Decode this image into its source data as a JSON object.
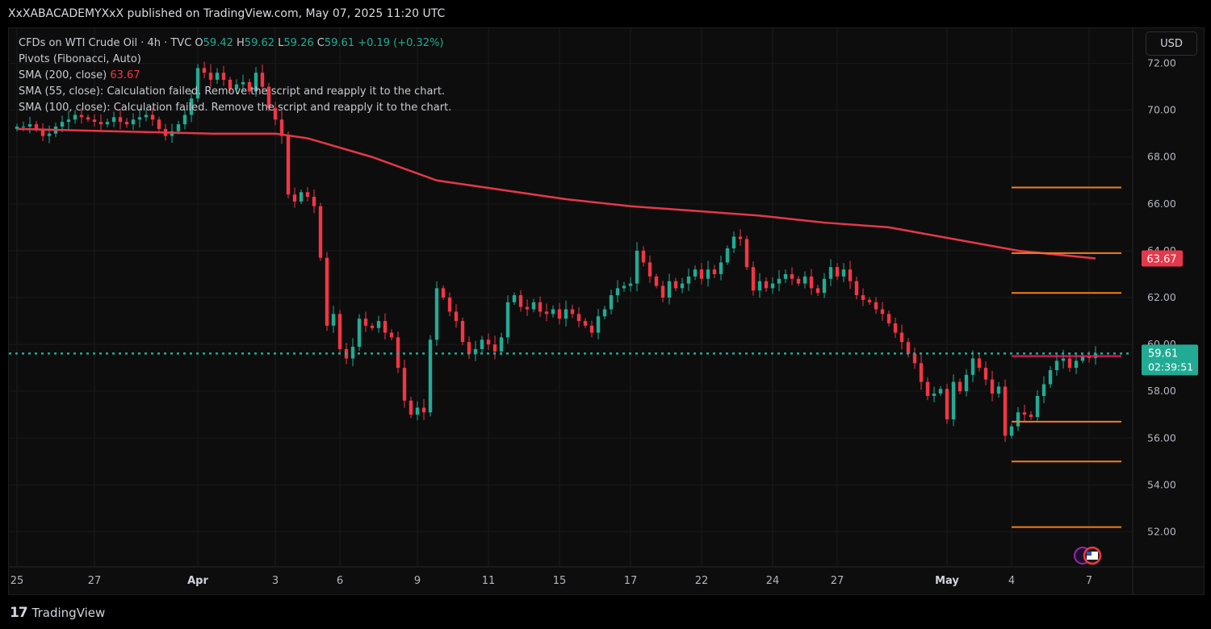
{
  "header": {
    "published": "XxXABACADEMYXxX published on TradingView.com, May 07, 2025 11:20 UTC"
  },
  "legend": {
    "symbol": "CFDs on WTI Crude Oil · 4h · TVC",
    "o_label": "O",
    "o_value": "59.42",
    "h_label": "H",
    "h_value": "59.62",
    "l_label": "L",
    "l_value": "59.26",
    "c_label": "C",
    "c_value": "59.61",
    "change": "+0.19 (+0.32%)",
    "pivots": "Pivots (Fibonacci, Auto)",
    "sma200_label": "SMA (200, close)",
    "sma200_value": "63.67",
    "sma55": "SMA (55, close): Calculation failed. Remove the script and reapply it to the chart.",
    "sma100": "SMA (100, close): Calculation failed. Remove the script and reapply it to the chart."
  },
  "currency_button": "USD",
  "price_tags": {
    "sma": "63.67",
    "last_price": "59.61",
    "countdown": "02:39:51"
  },
  "footer": {
    "logo": "17",
    "brand": "TradingView"
  },
  "colors": {
    "up": "#22ab94",
    "down": "#f23645",
    "sma": "#e5384a",
    "pivot": "#f57f17",
    "pivot_current": "#e91e63",
    "last_price": "#22ab94"
  },
  "chart_data": {
    "type": "candlestick",
    "title": "CFDs on WTI Crude Oil · 4h · TVC",
    "ylim": [
      50.5,
      73.5
    ],
    "y_ticks": [
      "52.00",
      "54.00",
      "56.00",
      "58.00",
      "60.00",
      "62.00",
      "64.00",
      "66.00",
      "68.00",
      "70.00",
      "72.00"
    ],
    "x_ticks": [
      {
        "label": "25",
        "bar": 0
      },
      {
        "label": "27",
        "bar": 12
      },
      {
        "label": "Apr",
        "bar": 28,
        "bold": true
      },
      {
        "label": "3",
        "bar": 40
      },
      {
        "label": "6",
        "bar": 50
      },
      {
        "label": "9",
        "bar": 62
      },
      {
        "label": "11",
        "bar": 73
      },
      {
        "label": "15",
        "bar": 84
      },
      {
        "label": "17",
        "bar": 95
      },
      {
        "label": "22",
        "bar": 106
      },
      {
        "label": "24",
        "bar": 117
      },
      {
        "label": "27",
        "bar": 127
      },
      {
        "label": "May",
        "bar": 144,
        "bold": true
      },
      {
        "label": "4",
        "bar": 154
      },
      {
        "label": "7",
        "bar": 166
      }
    ],
    "closes": [
      69.3,
      69.3,
      69.4,
      69.2,
      68.9,
      69.0,
      69.3,
      69.5,
      69.6,
      69.8,
      69.7,
      69.6,
      69.5,
      69.4,
      69.5,
      69.7,
      69.5,
      69.4,
      69.6,
      69.7,
      69.8,
      69.6,
      69.2,
      68.9,
      69.1,
      69.4,
      69.8,
      70.5,
      71.8,
      71.6,
      71.3,
      71.6,
      71.3,
      70.9,
      71.1,
      71.2,
      70.8,
      71.6,
      71.0,
      70.1,
      69.6,
      68.9,
      66.4,
      66.1,
      66.5,
      66.3,
      65.9,
      63.7,
      60.8,
      61.3,
      59.8,
      59.4,
      59.9,
      61.1,
      60.8,
      60.7,
      61.0,
      60.5,
      60.3,
      59.0,
      57.6,
      57.0,
      57.3,
      57.1,
      60.2,
      62.4,
      62.0,
      61.4,
      61.0,
      60.1,
      59.6,
      59.8,
      60.2,
      60.0,
      59.7,
      60.3,
      61.8,
      62.1,
      61.6,
      61.5,
      61.8,
      61.4,
      61.3,
      61.5,
      61.1,
      61.5,
      61.3,
      61.0,
      60.8,
      60.5,
      61.2,
      61.5,
      62.1,
      62.4,
      62.5,
      62.6,
      64.0,
      63.5,
      62.9,
      62.5,
      62.0,
      62.7,
      62.4,
      62.6,
      62.9,
      63.2,
      62.8,
      63.2,
      63.0,
      63.5,
      64.1,
      64.6,
      64.5,
      63.3,
      62.3,
      62.7,
      62.4,
      62.6,
      62.8,
      63.0,
      62.8,
      62.6,
      62.9,
      62.4,
      62.2,
      62.8,
      63.3,
      62.9,
      63.2,
      62.7,
      62.1,
      61.9,
      61.8,
      61.5,
      61.3,
      60.9,
      60.5,
      60.1,
      59.6,
      59.2,
      58.4,
      57.8,
      57.9,
      58.1,
      56.8,
      58.4,
      58.0,
      58.7,
      59.4,
      59.0,
      58.5,
      57.9,
      58.2,
      56.1,
      56.5,
      57.1,
      57.0,
      56.9,
      57.8,
      58.3,
      58.9,
      59.3,
      59.4,
      59.0,
      59.3,
      59.5,
      59.42,
      59.61
    ],
    "sma200": {
      "name": "SMA (200, close)",
      "points": [
        [
          0,
          69.2
        ],
        [
          30,
          69.0
        ],
        [
          40,
          69.0
        ],
        [
          45,
          68.8
        ],
        [
          55,
          68.0
        ],
        [
          65,
          67.0
        ],
        [
          75,
          66.6
        ],
        [
          85,
          66.2
        ],
        [
          95,
          65.9
        ],
        [
          105,
          65.7
        ],
        [
          115,
          65.5
        ],
        [
          125,
          65.2
        ],
        [
          135,
          65.0
        ],
        [
          145,
          64.5
        ],
        [
          155,
          64.0
        ],
        [
          167,
          63.67
        ]
      ]
    },
    "pivots": {
      "start_bar": 154,
      "end_bar": 171,
      "levels": [
        66.7,
        63.9,
        62.2,
        59.5,
        56.7,
        55.0,
        52.2
      ],
      "current_level": 59.5
    },
    "last_price": 59.61
  }
}
